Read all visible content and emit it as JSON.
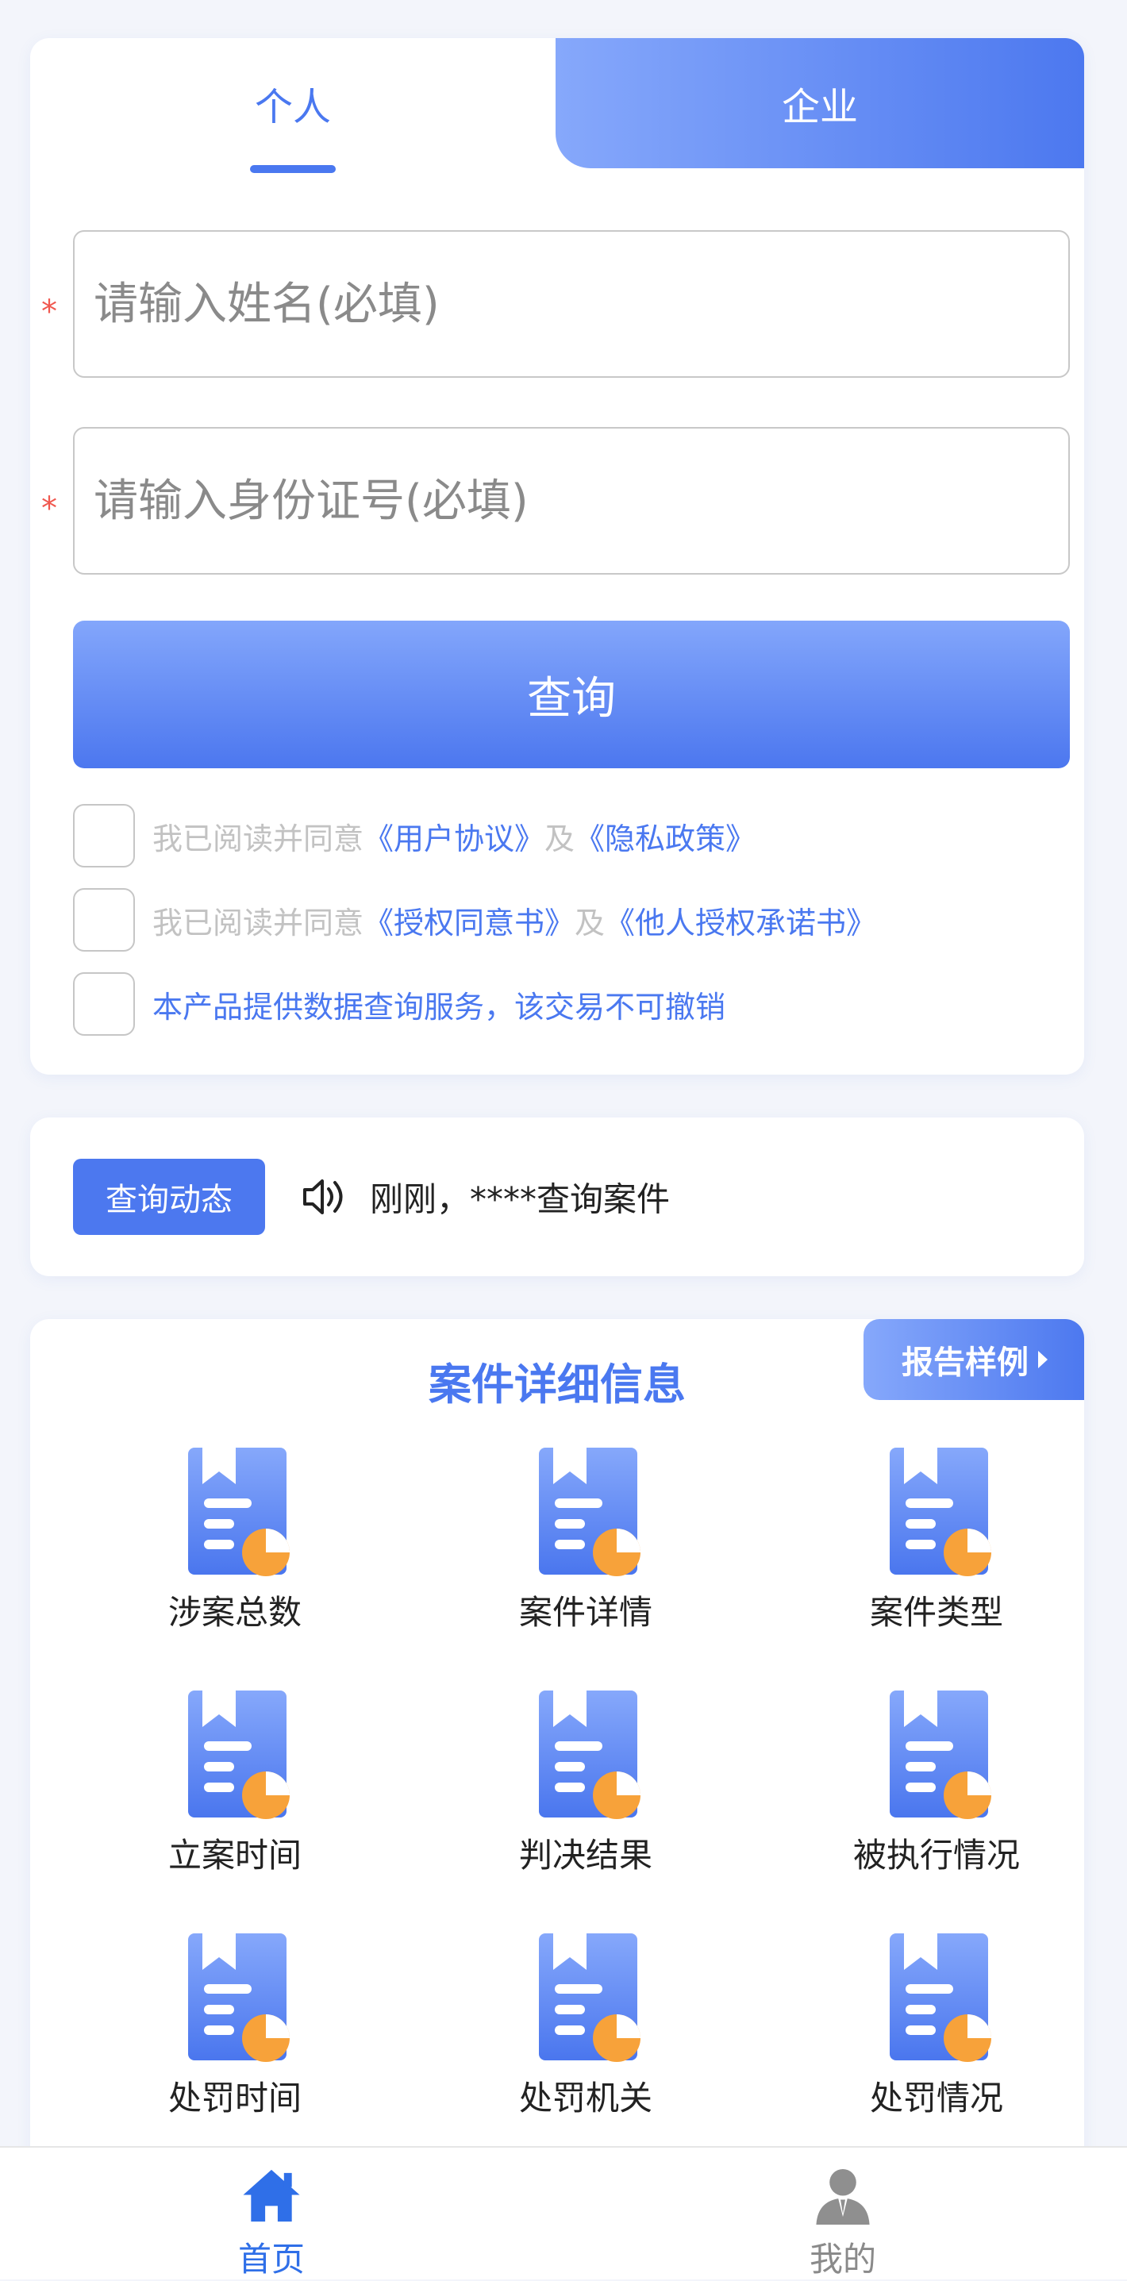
{
  "tabs": {
    "personal": "个人",
    "company": "企业"
  },
  "form": {
    "required_mark": "*",
    "name_placeholder": "请输入姓名(必填)",
    "id_placeholder": "请输入身份证号(必填)",
    "query_label": "查询"
  },
  "agreements": [
    {
      "prefix": "我已阅读并同意",
      "link1": "《用户协议》",
      "joiner": "及",
      "link2": "《隐私政策》"
    },
    {
      "prefix": "我已阅读并同意",
      "link1": "《授权同意书》",
      "joiner": "及",
      "link2": "《他人授权承诺书》"
    },
    {
      "notice": "本产品提供数据查询服务，该交易不可撤销"
    }
  ],
  "ticker": {
    "badge": "查询动态",
    "message": "刚刚，****查询案件"
  },
  "details": {
    "title": "案件详细信息",
    "sample_label": "报告样例",
    "items": [
      "涉案总数",
      "案件详情",
      "案件类型",
      "立案时间",
      "判决结果",
      "被执行情况",
      "处罚时间",
      "处罚机关",
      "处罚情况"
    ]
  },
  "nav": {
    "home": "首页",
    "mine": "我的"
  },
  "colors": {
    "accent": "#4a78f0",
    "required": "#f0584f",
    "orange": "#f7a23a"
  }
}
